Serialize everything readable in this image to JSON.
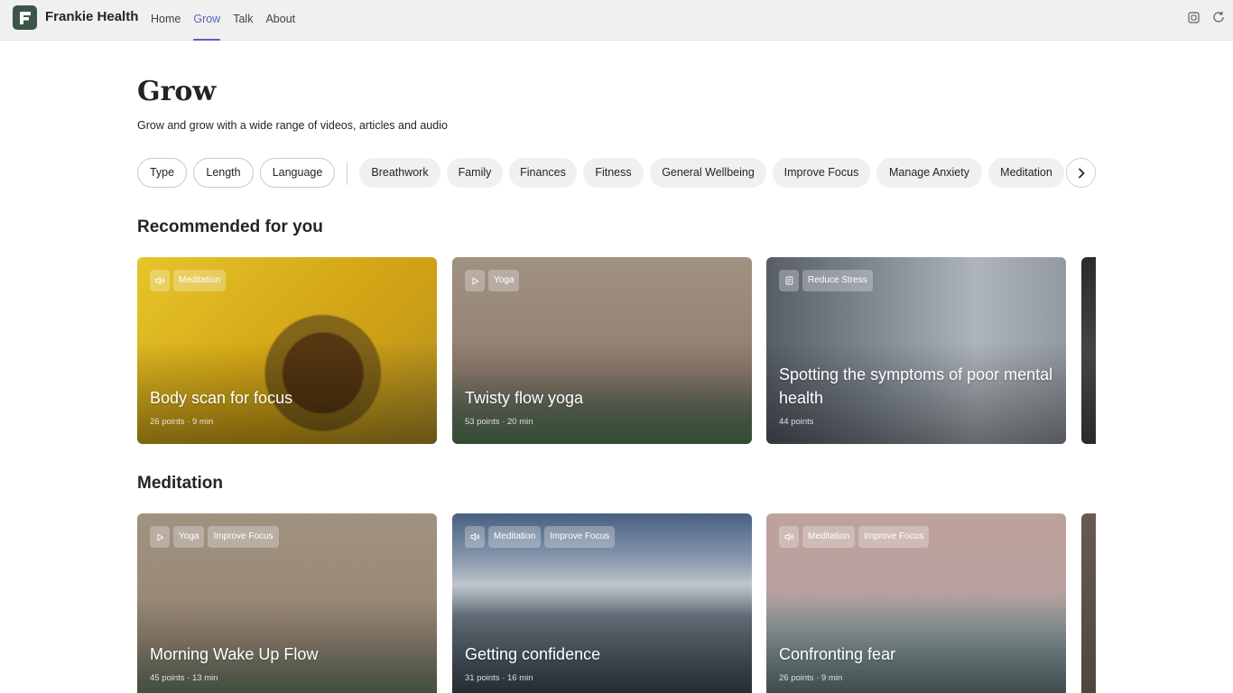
{
  "app": {
    "name": "Frankie Health",
    "nav": [
      "Home",
      "Grow",
      "Talk",
      "About"
    ],
    "active_nav": "Grow"
  },
  "header": {
    "title": "Grow",
    "subtitle": "Grow and grow with a wide range of videos, articles and audio"
  },
  "filters": {
    "dropdowns": [
      "Type",
      "Length",
      "Language"
    ],
    "topics": [
      "Breathwork",
      "Family",
      "Finances",
      "Fitness",
      "General Wellbeing",
      "Improve Focus",
      "Manage Anxiety",
      "Meditation"
    ]
  },
  "sections": [
    {
      "title": "Recommended for you",
      "cards": [
        {
          "media": "audio-icon",
          "tags": [
            "Meditation"
          ],
          "title": "Body scan for focus",
          "meta": "26 points · 9 min"
        },
        {
          "media": "play-icon",
          "tags": [
            "Yoga"
          ],
          "title": "Twisty flow yoga",
          "meta": "53 points · 20 min"
        },
        {
          "media": "article-icon",
          "tags": [
            "Reduce Stress"
          ],
          "title": "Spotting the symptoms of poor mental health",
          "meta": "44 points"
        }
      ]
    },
    {
      "title": "Meditation",
      "cards": [
        {
          "media": "play-icon",
          "tags": [
            "Yoga",
            "Improve Focus"
          ],
          "title": "Morning Wake Up Flow",
          "meta": "45 points · 13 min"
        },
        {
          "media": "audio-icon",
          "tags": [
            "Meditation",
            "Improve Focus"
          ],
          "title": "Getting confidence",
          "meta": "31 points · 16 min"
        },
        {
          "media": "audio-icon",
          "tags": [
            "Meditation",
            "Improve Focus"
          ],
          "title": "Confronting fear",
          "meta": "26 points · 9 min"
        }
      ]
    }
  ],
  "colors": {
    "accent": "#5b5fc7",
    "logo": "#3b5648",
    "topbar": "#f0f0f0"
  }
}
